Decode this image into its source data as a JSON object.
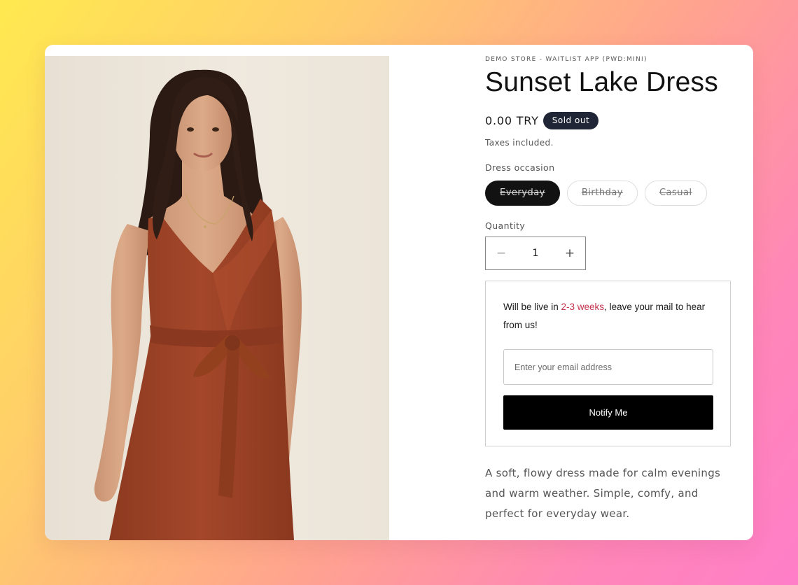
{
  "product": {
    "vendor": "DEMO STORE - WAITLIST APP (PWD:MINI)",
    "title": "Sunset Lake Dress",
    "price": "0.00 TRY",
    "badge": "Sold out",
    "tax_note": "Taxes included.",
    "description": "A soft, flowy dress made for calm evenings and warm weather. Simple, comfy, and perfect for everyday wear.",
    "image_icon": "product-photo-woman-in-rust-wrap-dress"
  },
  "variant": {
    "label": "Dress occasion",
    "options": [
      "Everyday",
      "Birthday",
      "Casual"
    ],
    "selected": "Everyday"
  },
  "quantity": {
    "label": "Quantity",
    "value": "1",
    "minus_icon": "minus-icon",
    "plus_icon": "plus-icon"
  },
  "waitlist": {
    "message_before": "Will be live in ",
    "message_accent": "2-3 weeks",
    "message_after": ", leave your mail to hear from us!",
    "email_placeholder": "Enter your email address",
    "button_label": "Notify Me"
  },
  "colors": {
    "badge_bg": "#202636",
    "accent_text": "#c2314a",
    "selected_pill": "#121212",
    "dress": "#9c4326",
    "photo_backdrop": "#ede6dc"
  }
}
